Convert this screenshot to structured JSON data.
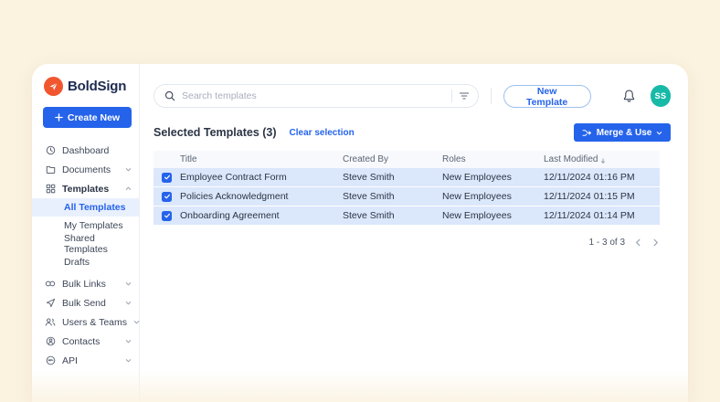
{
  "app": {
    "brand": "BoldSign"
  },
  "colors": {
    "accent_blue": "#2563eb",
    "brand_orange": "#f1562e",
    "avatar_teal": "#17b9a7",
    "selected_row_bg": "#dbe7fb",
    "page_background": "#fbf2df"
  },
  "sidebar": {
    "create_button_label": "Create New",
    "items": [
      {
        "label": "Dashboard",
        "icon": "clock-icon",
        "chevron": "none"
      },
      {
        "label": "Documents",
        "icon": "folder-icon",
        "chevron": "down"
      },
      {
        "label": "Templates",
        "icon": "grid-icon",
        "chevron": "up",
        "expanded": true
      },
      {
        "label": "All Templates",
        "sub": true,
        "active": true
      },
      {
        "label": "My Templates",
        "sub": true
      },
      {
        "label": "Shared Templates",
        "sub": true
      },
      {
        "label": "Drafts",
        "sub": true
      },
      {
        "label": "Bulk Links",
        "icon": "links-icon",
        "chevron": "down"
      },
      {
        "label": "Bulk Send",
        "icon": "send-icon",
        "chevron": "down"
      },
      {
        "label": "Users & Teams",
        "icon": "users-icon",
        "chevron": "down"
      },
      {
        "label": "Contacts",
        "icon": "contact-icon",
        "chevron": "down"
      },
      {
        "label": "API",
        "icon": "api-icon",
        "chevron": "down"
      }
    ]
  },
  "topbar": {
    "search_placeholder": "Search templates",
    "new_template_label": "New Template",
    "avatar_initials": "SS"
  },
  "toolbar": {
    "selected_title": "Selected Templates (3)",
    "clear_selection_label": "Clear selection",
    "merge_use_label": "Merge & Use"
  },
  "table": {
    "headers": {
      "title": "Title",
      "created_by": "Created By",
      "roles": "Roles",
      "last_modified": "Last Modified"
    },
    "rows": [
      {
        "checked": true,
        "title": "Employee Contract Form",
        "created_by": "Steve Smith",
        "roles": "New Employees",
        "last_modified": "12/11/2024 01:16 PM"
      },
      {
        "checked": true,
        "title": "Policies Acknowledgment",
        "created_by": "Steve Smith",
        "roles": "New Employees",
        "last_modified": "12/11/2024 01:15 PM"
      },
      {
        "checked": true,
        "title": "Onboarding Agreement",
        "created_by": "Steve Smith",
        "roles": "New Employees",
        "last_modified": "12/11/2024 01:14 PM"
      }
    ]
  },
  "pagination": {
    "range_label": "1 - 3 of 3"
  }
}
